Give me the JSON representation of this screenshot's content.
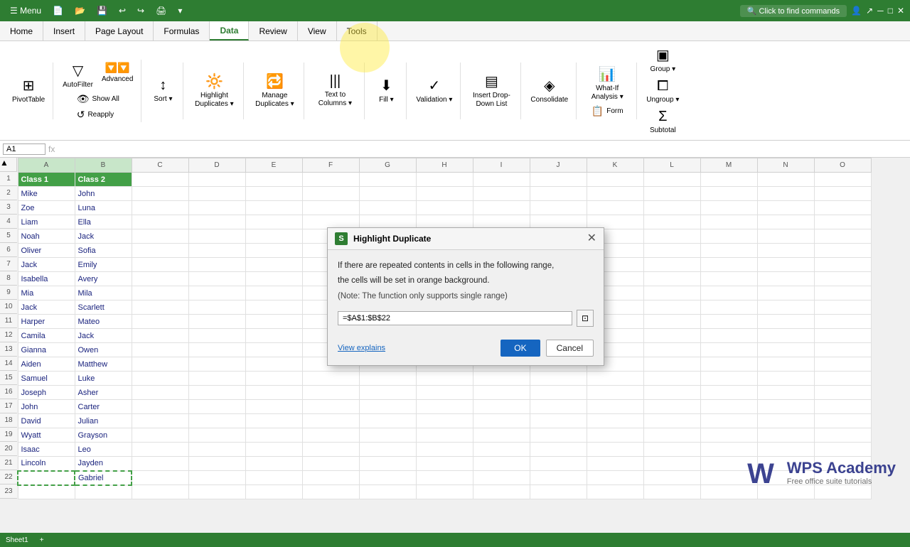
{
  "titleBar": {
    "menu": "☰  Menu",
    "tabs": [
      "Home",
      "Insert",
      "Page Layout",
      "Formulas",
      "Data",
      "Review",
      "View",
      "Tools"
    ],
    "activeTab": "Data",
    "searchPlaceholder": "Click to find commands",
    "rightIcons": [
      "user-icon",
      "share-icon",
      "window-controls"
    ]
  },
  "ribbon": {
    "groups": [
      {
        "name": "pivot",
        "buttons": [
          {
            "label": "PivotTable",
            "icon": "⊞"
          }
        ]
      },
      {
        "name": "filter",
        "buttons": [
          {
            "label": "AutoFilter",
            "icon": "▽"
          },
          {
            "label": "Advanced",
            "icon": "▽▽"
          }
        ],
        "smallButtons": [
          {
            "label": "Show All",
            "icon": "👁"
          },
          {
            "label": "Reapply",
            "icon": "↺"
          }
        ]
      },
      {
        "name": "sort",
        "buttons": [
          {
            "label": "Sort ▾",
            "icon": "↕"
          }
        ]
      },
      {
        "name": "highlight",
        "buttons": [
          {
            "label": "Highlight Duplicates ▾",
            "icon": "🔆"
          }
        ]
      },
      {
        "name": "manage",
        "buttons": [
          {
            "label": "Manage Duplicates ▾",
            "icon": "🔁"
          }
        ]
      },
      {
        "name": "text",
        "buttons": [
          {
            "label": "Text to Columns ▾",
            "icon": "|||"
          }
        ]
      },
      {
        "name": "fill",
        "buttons": [
          {
            "label": "Fill ▾",
            "icon": "⬇"
          }
        ]
      },
      {
        "name": "validation",
        "buttons": [
          {
            "label": "Validation ▾",
            "icon": "✓"
          }
        ]
      },
      {
        "name": "dropdown",
        "buttons": [
          {
            "label": "Insert Drop-Down List",
            "icon": "▤"
          }
        ]
      },
      {
        "name": "consolidate",
        "buttons": [
          {
            "label": "Consolidate",
            "icon": "◈"
          }
        ]
      },
      {
        "name": "whatif",
        "buttons": [
          {
            "label": "What-If Analysis ▾",
            "icon": "📊"
          },
          {
            "label": "Form",
            "icon": "📋"
          }
        ]
      },
      {
        "name": "group",
        "buttons": [
          {
            "label": "Group ▾",
            "icon": "▣"
          },
          {
            "label": "Ungroup ▾",
            "icon": "⧠"
          },
          {
            "label": "Subtotal",
            "icon": "Σ"
          }
        ]
      }
    ]
  },
  "formulaBar": {
    "cellRef": "A1",
    "formula": ""
  },
  "columns": [
    "A",
    "B",
    "C",
    "D",
    "E",
    "F",
    "G",
    "H",
    "I",
    "J",
    "K",
    "L",
    "M",
    "N",
    "O"
  ],
  "rows": [
    1,
    2,
    3,
    4,
    5,
    6,
    7,
    8,
    9,
    10,
    11,
    12,
    13,
    14,
    15,
    16,
    17,
    18,
    19,
    20,
    21,
    22,
    23
  ],
  "cellData": {
    "A1": {
      "value": "Class 1",
      "class": "class1-header"
    },
    "B1": {
      "value": "Class 2",
      "class": "class2-header"
    },
    "A2": {
      "value": "Mike",
      "class": "data-a"
    },
    "B2": {
      "value": "John",
      "class": "data-b"
    },
    "A3": {
      "value": "Zoe",
      "class": "data-a"
    },
    "B3": {
      "value": "Luna",
      "class": "data-b"
    },
    "A4": {
      "value": "Liam",
      "class": "data-a"
    },
    "B4": {
      "value": "Ella",
      "class": "data-b"
    },
    "A5": {
      "value": "Noah",
      "class": "data-a"
    },
    "B5": {
      "value": "Jack",
      "class": "data-b"
    },
    "A6": {
      "value": "Oliver",
      "class": "data-a"
    },
    "B6": {
      "value": "Sofia",
      "class": "data-b"
    },
    "A7": {
      "value": "Jack",
      "class": "data-a"
    },
    "B7": {
      "value": "Emily",
      "class": "data-b"
    },
    "A8": {
      "value": "Isabella",
      "class": "data-a"
    },
    "B8": {
      "value": "Avery",
      "class": "data-b"
    },
    "A9": {
      "value": "Mia",
      "class": "data-a"
    },
    "B9": {
      "value": "Mila",
      "class": "data-b"
    },
    "A10": {
      "value": "Jack",
      "class": "data-a"
    },
    "B10": {
      "value": "Scarlett",
      "class": "data-b"
    },
    "A11": {
      "value": "Harper",
      "class": "data-a"
    },
    "B11": {
      "value": "Mateo",
      "class": "data-b"
    },
    "A12": {
      "value": "Camila",
      "class": "data-a"
    },
    "B12": {
      "value": "Jack",
      "class": "data-b"
    },
    "A13": {
      "value": "Gianna",
      "class": "data-a"
    },
    "B13": {
      "value": "Owen",
      "class": "data-b"
    },
    "A14": {
      "value": "Aiden",
      "class": "data-a"
    },
    "B14": {
      "value": "Matthew",
      "class": "data-b"
    },
    "A15": {
      "value": "Samuel",
      "class": "data-a"
    },
    "B15": {
      "value": "Luke",
      "class": "data-b"
    },
    "A16": {
      "value": "Joseph",
      "class": "data-a"
    },
    "B16": {
      "value": "Asher",
      "class": "data-b"
    },
    "A17": {
      "value": "John",
      "class": "data-a"
    },
    "B17": {
      "value": "Carter",
      "class": "data-b"
    },
    "A18": {
      "value": "David",
      "class": "data-a"
    },
    "B18": {
      "value": "Julian",
      "class": "data-b"
    },
    "A19": {
      "value": "Wyatt",
      "class": "data-a"
    },
    "B19": {
      "value": "Grayson",
      "class": "data-b"
    },
    "A20": {
      "value": "Isaac",
      "class": "data-a"
    },
    "B20": {
      "value": "Leo",
      "class": "data-b"
    },
    "A21": {
      "value": "Lincoln",
      "class": "data-a"
    },
    "B21": {
      "value": "Jayden",
      "class": "data-b"
    },
    "B22": {
      "value": "Gabriel",
      "class": "data-b dashed-border"
    }
  },
  "dialog": {
    "title": "Highlight Duplicate",
    "iconLabel": "S",
    "line1": "If there are repeated contents in cells in the following range,",
    "line2": "the cells will be set in orange background.",
    "note": "(Note: The function only supports single range)",
    "rangeValue": "=$A$1:$B$22",
    "viewExplains": "View explains",
    "okLabel": "OK",
    "cancelLabel": "Cancel"
  },
  "statusBar": {
    "sheetName": "Sheet1",
    "info": ""
  },
  "wps": {
    "brand": "WPS Academy",
    "tagline": "Free office suite tutorials"
  }
}
